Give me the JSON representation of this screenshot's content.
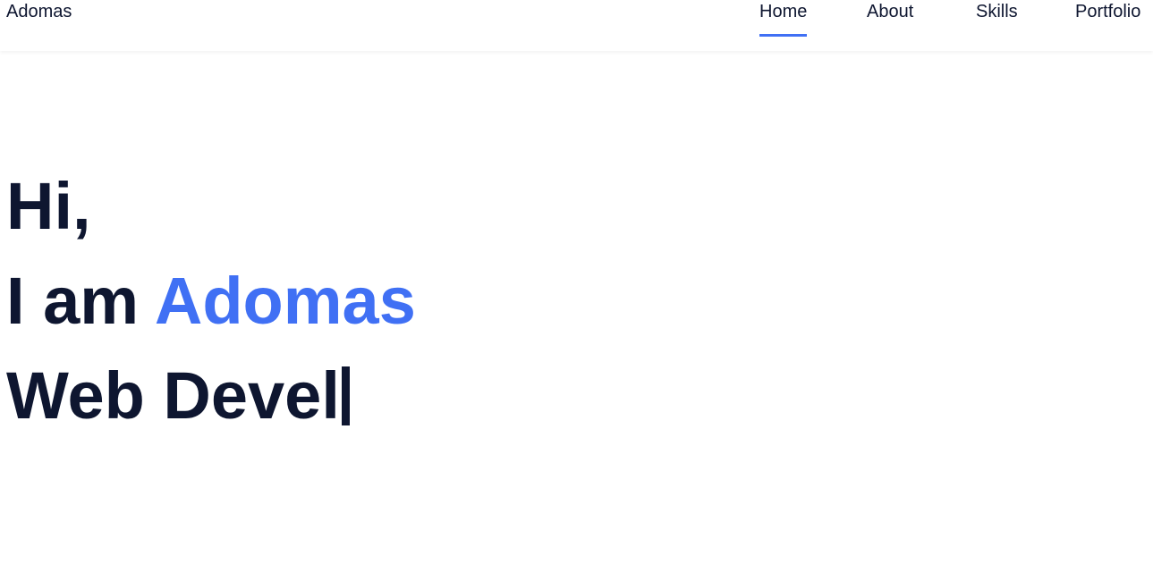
{
  "nav": {
    "logo": "Adomas",
    "links": [
      {
        "label": "Home",
        "active": true
      },
      {
        "label": "About"
      },
      {
        "label": "Skills"
      },
      {
        "label": "Portfolio"
      }
    ]
  },
  "hero": {
    "greeting": "Hi,",
    "intro": "I am",
    "name": "Adomas",
    "typed_text": "Web Devel"
  },
  "colors": {
    "accent": "#4070f4",
    "text": "#0e1630"
  }
}
